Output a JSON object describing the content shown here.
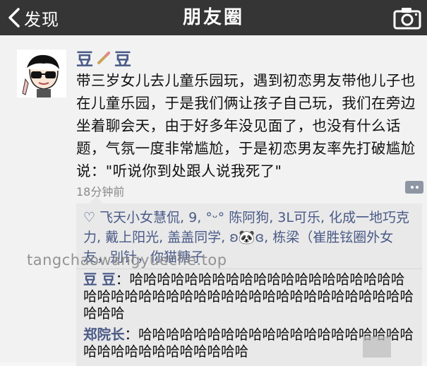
{
  "nav": {
    "back_label": "发现",
    "title": "朋友圈",
    "camera_icon": "camera-icon",
    "back_icon": "chevron-left-icon"
  },
  "post": {
    "author_a": "豆",
    "author_b": "豆",
    "content": "带三岁女儿去儿童乐园玩，遇到初恋男友带他儿子也在儿童乐园，于是我们俩让孩子自己玩，我们在旁边坐着聊会天，由于好多年没见面了，也没有什么话题，气氛一度非常尴尬，于是初恋男友率先打破尴尬说：\"听说你到处跟人说我死了\"",
    "time": "18分钟前"
  },
  "likes": {
    "text": "飞天小女慧侃, 9, °ᵕ° 陈阿狗, 3L可乐, 化成一地巧克力, 戴上阳光, 盖盖同学, ʚ🐼ɞ, 栋梁（崔胜铉圈外女友，别针，你猫糖子"
  },
  "comments": [
    {
      "name": "豆 豆",
      "text": "哈哈哈哈哈哈哈哈哈哈哈哈哈哈哈哈哈哈哈哈哈哈哈哈哈哈哈哈哈哈哈哈哈哈哈哈哈哈哈哈哈哈哈哈哈哈哈"
    },
    {
      "name": "郑院长",
      "text": "哈哈哈哈哈哈哈哈哈哈哈哈哈哈哈哈哈哈哈哈哈哈哈哈哈哈哈哈哈哈哈哈"
    }
  ],
  "watermark": "tangchaowangyueche.top",
  "colors": {
    "nav_bg": "#353535",
    "name_blue": "#4a5a87",
    "comment_bg": "#e9e9e9"
  }
}
